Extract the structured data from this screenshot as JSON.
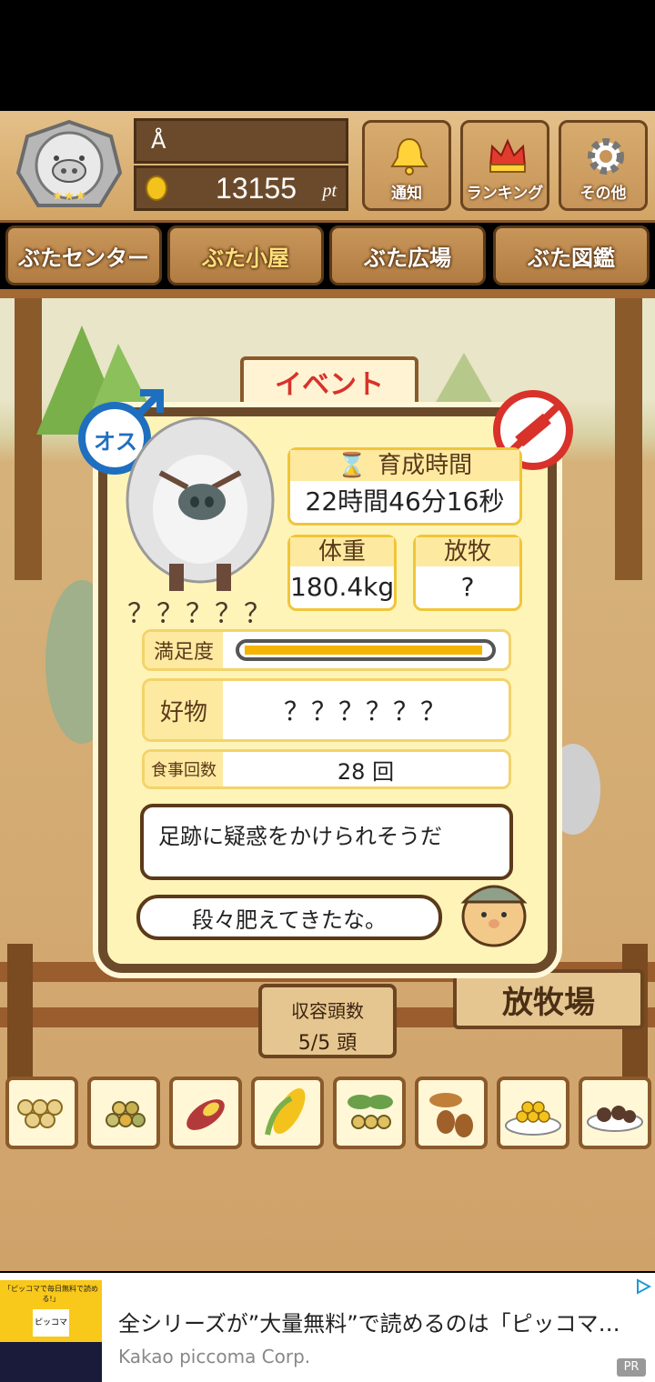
{
  "player": {
    "name": "Å",
    "points": "13155",
    "points_unit": "pt"
  },
  "top_buttons": [
    {
      "label": "通知",
      "icon": "bell-icon"
    },
    {
      "label": "ランキング",
      "icon": "crown-icon"
    },
    {
      "label": "その他",
      "icon": "gear-icon"
    }
  ],
  "tabs": [
    {
      "label": "ぶたセンター",
      "active": false
    },
    {
      "label": "ぶた小屋",
      "active": true
    },
    {
      "label": "ぶた広場",
      "active": false
    },
    {
      "label": "ぶた図鑑",
      "active": false
    }
  ],
  "scene": {
    "event_sign": "イベント",
    "pasture_sign": "放牧場",
    "capacity_label": "収容頭数",
    "capacity_value": "5/5 頭"
  },
  "pig": {
    "gender": "オス",
    "name": "？？？？？",
    "growth_time_label": "育成時間",
    "growth_time": "22時間46分16秒",
    "weight_label": "体重",
    "weight": "180.4kg",
    "grazing_label": "放牧",
    "grazing": "?",
    "satisfaction_label": "満足度",
    "satisfaction": 0.98,
    "favorite_label": "好物",
    "favorite": "？？？？？？",
    "meals_label": "食事回数",
    "meals": "28 回",
    "comment": "足跡に疑惑をかけられそうだ",
    "farmer_comment": "段々肥えてきたな。"
  },
  "foods": [
    "soybean-icon",
    "mixed-grain-icon",
    "sweet-potato-icon",
    "corn-icon",
    "herb-berries-icon",
    "acorn-icon",
    "corn-plate-icon",
    "truffle-plate-icon"
  ],
  "ad": {
    "title": "全シリーズが”大量無料”で読めるのは「ピッコマ…",
    "advertiser": "Kakao piccoma Corp.",
    "badge": "PR",
    "thumb_text_1": "「ピッコマで毎日無料で読める!」",
    "thumb_text_2": "ピッコマ"
  },
  "colors": {
    "accent": "#f4b400",
    "wood": "#6b4a2b",
    "panel": "#fff4b8",
    "male": "#1e6fc0",
    "no_vaccine": "#d8322a"
  }
}
